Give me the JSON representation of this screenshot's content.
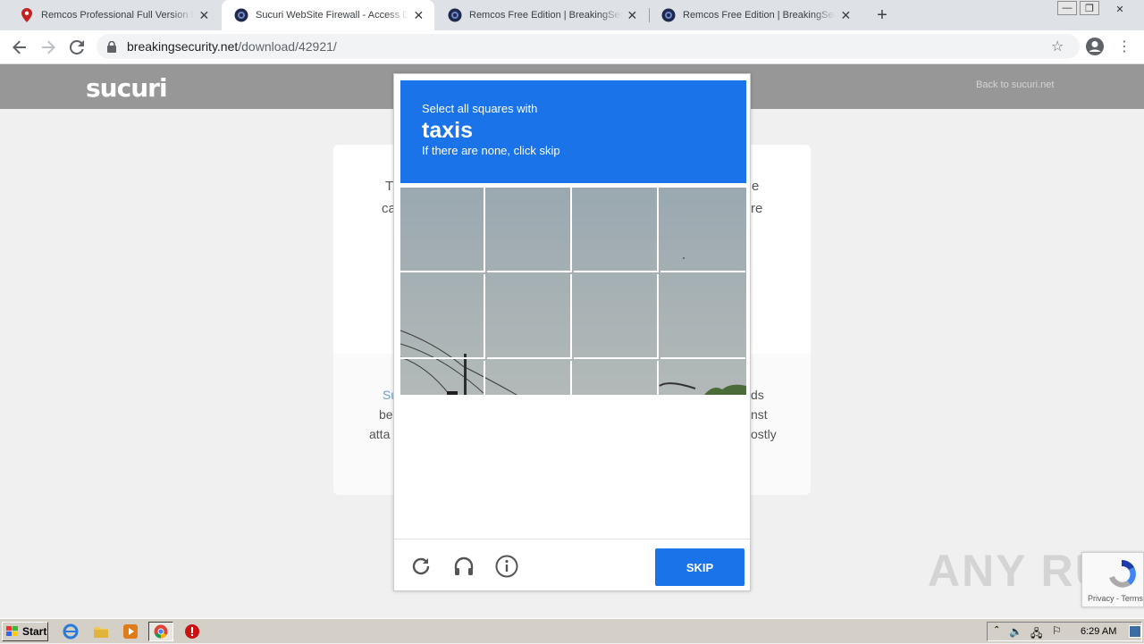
{
  "tabs": [
    {
      "title": "Remcos Professional Full Version Download",
      "active": false,
      "icon": "map-pin-icon"
    },
    {
      "title": "Sucuri WebSite Firewall - Access Denied",
      "active": true,
      "icon": "globe-icon"
    },
    {
      "title": "Remcos Free Edition | BreakingSecurity",
      "active": false,
      "icon": "globe-icon"
    },
    {
      "title": "Remcos Free Edition | BreakingSecurity",
      "active": false,
      "icon": "globe-icon"
    }
  ],
  "toolbar": {
    "url_host": "breakingsecurity.net",
    "url_path": "/download/42921/"
  },
  "page": {
    "logo": "sucuri",
    "back_link": "Back to sucuri.net",
    "bg_fragments": {
      "line1_left": "T",
      "line1_right": "e",
      "line2_left": "ca",
      "line2_right": "re",
      "line3_left": "Su",
      "line3_right": "ds",
      "line4_left": "be",
      "line4_right": "nst",
      "line5_left": "atta",
      "line5_right": "ostly"
    }
  },
  "captcha": {
    "prompt": "Select all squares with",
    "target": "taxis",
    "hint": "If there are none, click skip",
    "skip_label": "SKIP",
    "icons": [
      "reload-icon",
      "audio-icon",
      "info-icon"
    ]
  },
  "watermark": "ANY RUN",
  "recaptcha_badge": {
    "terms": "Privacy - Terms"
  },
  "taskbar": {
    "start_label": "Start",
    "clock": "6:29 AM"
  },
  "colors": {
    "captcha_blue": "#1a73e8",
    "sucuri_header": "#979797"
  }
}
